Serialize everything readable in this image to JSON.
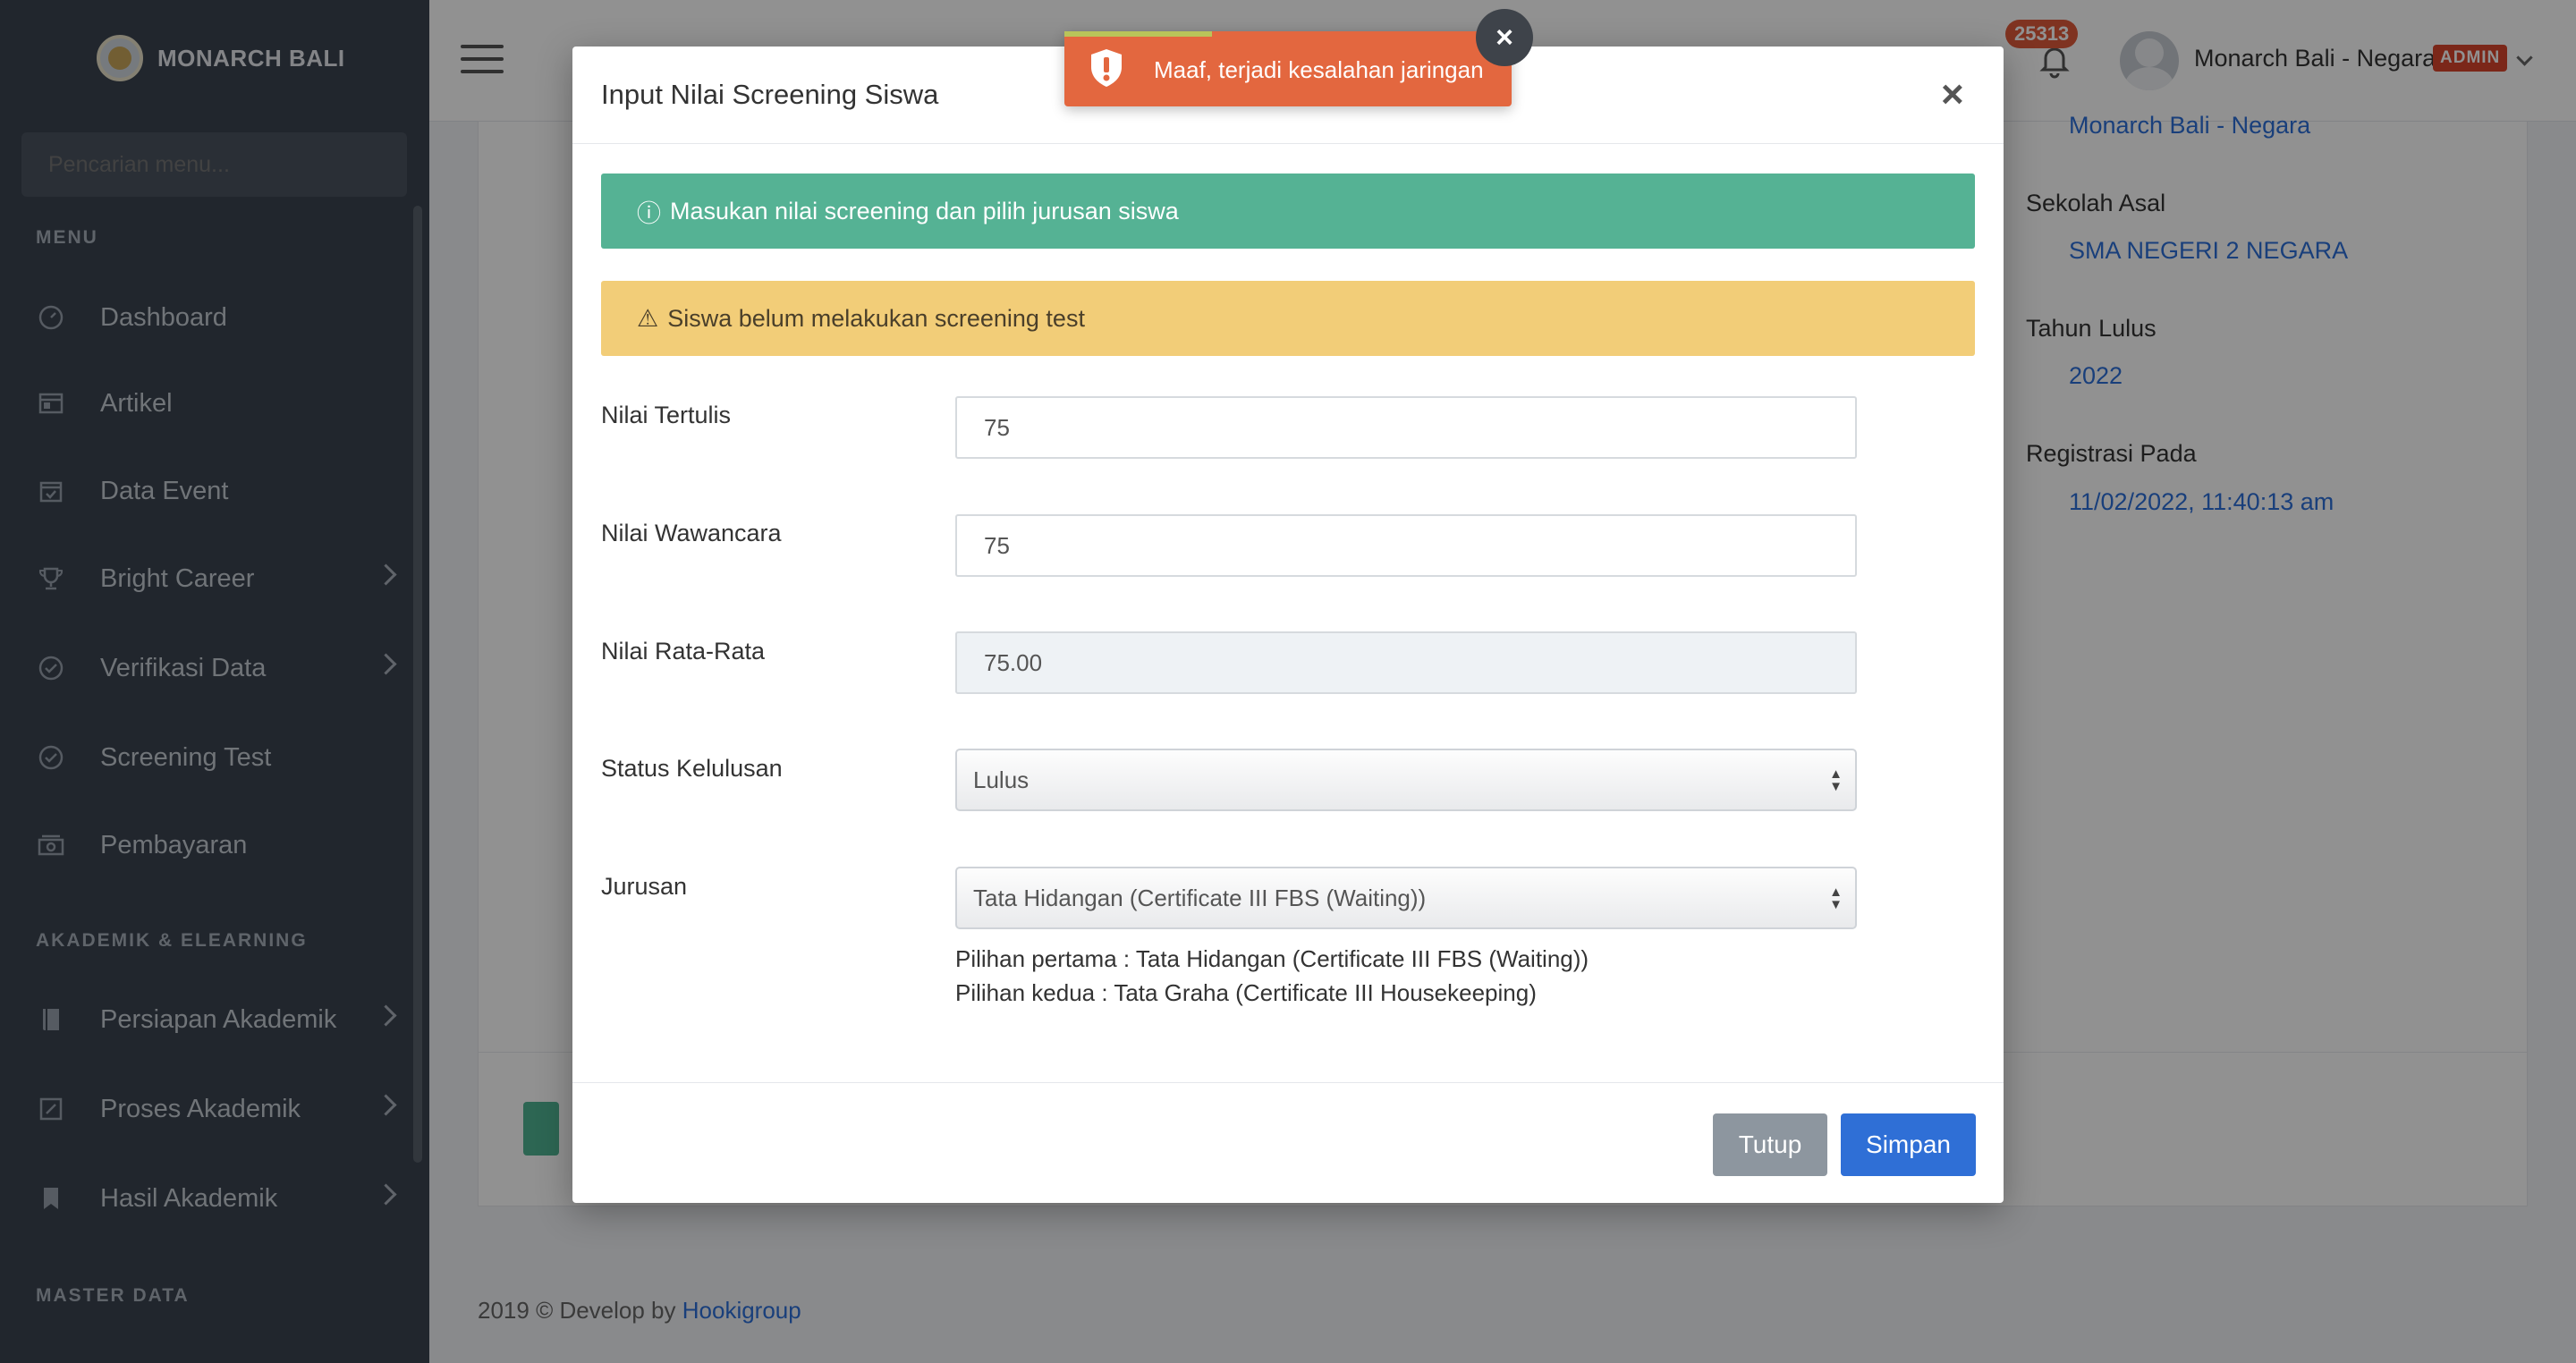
{
  "sidebar": {
    "brand": "MONARCH BALI",
    "search_placeholder": "Pencarian menu...",
    "section_menu": "MENU",
    "items": [
      {
        "label": "Dashboard",
        "icon": "gauge-icon"
      },
      {
        "label": "Artikel",
        "icon": "newspaper-icon"
      },
      {
        "label": "Data Event",
        "icon": "calendar-check-icon"
      },
      {
        "label": "Bright Career",
        "icon": "trophy-icon"
      },
      {
        "label": "Verifikasi Data",
        "icon": "check-circle-icon"
      },
      {
        "label": "Screening Test",
        "icon": "check-circle-icon"
      },
      {
        "label": "Pembayaran",
        "icon": "money-icon"
      }
    ],
    "section_akademik": "AKADEMIK & ELEARNING",
    "akademik_items": [
      {
        "label": "Persiapan Akademik",
        "icon": "book-icon"
      },
      {
        "label": "Proses Akademik",
        "icon": "edit-square-icon"
      },
      {
        "label": "Hasil Akademik",
        "icon": "bookmark-icon"
      }
    ],
    "section_master": "MASTER DATA"
  },
  "topbar": {
    "notification_count": "25313",
    "user_name": "Monarch Bali - Negara",
    "role_badge": "ADMIN"
  },
  "background_info": {
    "branch_value": "Monarch Bali - Negara",
    "sekolah_label": "Sekolah Asal",
    "sekolah_value": "SMA NEGERI 2 NEGARA",
    "tahun_label": "Tahun Lulus",
    "tahun_value": "2022",
    "registrasi_label": "Registrasi Pada",
    "registrasi_value": "11/02/2022, 11:40:13 am"
  },
  "footer": {
    "text": "2019 © Develop by ",
    "link": "Hookigroup"
  },
  "modal": {
    "title": "Input Nilai Screening Siswa",
    "alert_info": "Masukan nilai screening dan pilih jurusan siswa",
    "alert_warning": "Siswa belum melakukan screening test",
    "fields": {
      "tertulis_label": "Nilai Tertulis",
      "tertulis_value": "75",
      "wawancara_label": "Nilai Wawancara",
      "wawancara_value": "75",
      "rata_label": "Nilai Rata-Rata",
      "rata_value": "75.00",
      "status_label": "Status Kelulusan",
      "status_value": "Lulus",
      "jurusan_label": "Jurusan",
      "jurusan_value": "Tata Hidangan (Certificate III FBS (Waiting))"
    },
    "pilihan_pertama": "Pilihan pertama : Tata Hidangan (Certificate III FBS (Waiting))",
    "pilihan_kedua": "Pilihan kedua : Tata Graha (Certificate III Housekeeping)",
    "btn_close": "Tutup",
    "btn_save": "Simpan"
  },
  "toast": {
    "message": "Maaf, terjadi kesalahan jaringan",
    "icon": "warning-shield-icon",
    "progress": 0.33
  },
  "colors": {
    "sidebar_bg": "#3a4350",
    "primary": "#2f6fd6",
    "info_alert": "#55b294",
    "warning_alert": "#f2cd78",
    "toast": "#e3673f",
    "admin_badge": "#d9462d"
  }
}
